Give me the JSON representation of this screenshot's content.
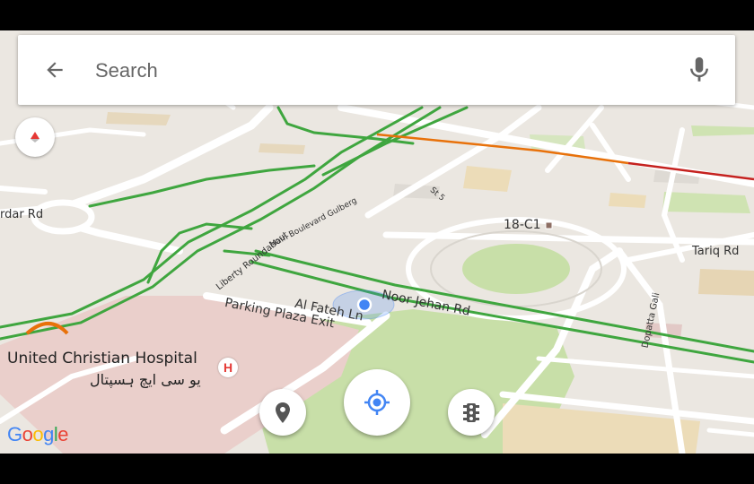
{
  "search": {
    "placeholder": "Search",
    "back_icon": "arrow-back-icon",
    "mic_icon": "mic-icon"
  },
  "map_labels": {
    "hospital_en": "United Christian Hospital",
    "hospital_ur": "یو سی ایچ ہسپتال",
    "hospital_badge": "H",
    "noor_jehan": "Noor Jehan Rd",
    "al_fateh": "Al Fateh Ln",
    "parking": "Parking Plaza Exit",
    "block": "18-C1",
    "tariq": "Tariq Rd",
    "dopatta": "Dopatta Gali",
    "ardar": "rdar Rd",
    "liberty": "Liberty Roundabout",
    "main_blvd": "Main Boulevard Gulberg",
    "st5": "St 5"
  },
  "buttons": {
    "compass_icon": "compass-icon",
    "place_icon": "place-pin-icon",
    "location_icon": "my-location-icon",
    "traffic_icon": "traffic-light-icon"
  },
  "branding": {
    "logo_letters": [
      "G",
      "o",
      "o",
      "g",
      "l",
      "e"
    ],
    "logo_colors": [
      "#4285F4",
      "#EA4335",
      "#FBBC05",
      "#4285F4",
      "#34A853",
      "#EA4335"
    ]
  },
  "colors": {
    "map_bg": "#ebe7e1",
    "road": "#ffffff",
    "traffic_green": "#3fa63f",
    "traffic_orange": "#e8710a",
    "traffic_red": "#c5221f",
    "park": "#c8dfa8",
    "hospital_area": "#eacfcb",
    "location_blue": "#4285F4"
  }
}
